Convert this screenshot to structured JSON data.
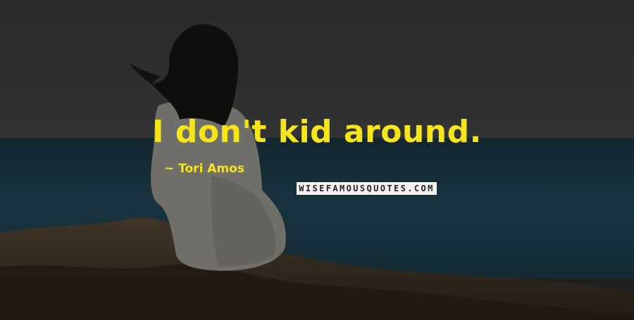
{
  "quote": {
    "text": "I don't kid around.",
    "author_line": "~ Tori Amos"
  },
  "watermark": {
    "text": "WISEFAMOUSQUOTES.COM"
  },
  "colors": {
    "text_yellow": "#f5e51a",
    "sky": "#3c3c3a",
    "sea": "#1f3b48",
    "rock": "#3f3427",
    "overlay": "rgba(0,0,0,0.45)"
  }
}
